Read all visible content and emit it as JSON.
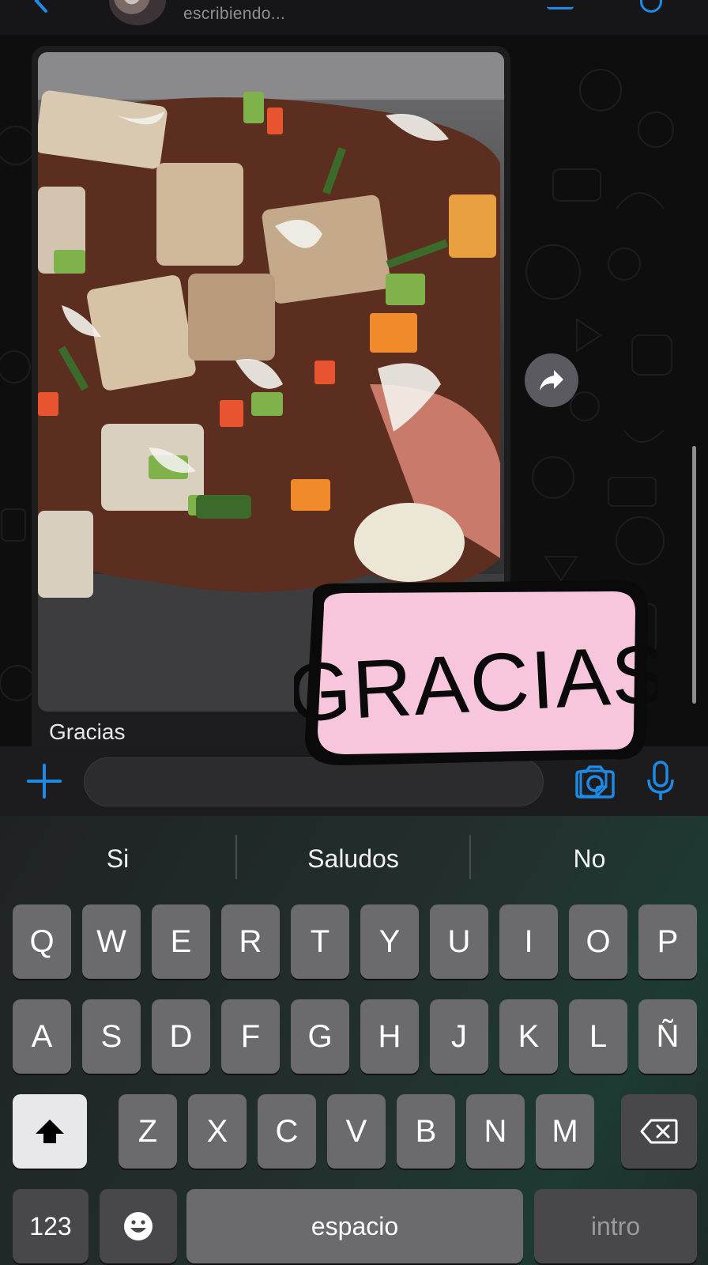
{
  "header": {
    "status": "escribiendo..."
  },
  "message": {
    "caption": "Gracias"
  },
  "sticker": {
    "text": "GRACIAS"
  },
  "input": {
    "value": "",
    "placeholder": ""
  },
  "keyboard": {
    "suggestions": [
      "Si",
      "Saludos",
      "No"
    ],
    "rows": [
      [
        "Q",
        "W",
        "E",
        "R",
        "T",
        "Y",
        "U",
        "I",
        "O",
        "P"
      ],
      [
        "A",
        "S",
        "D",
        "F",
        "G",
        "H",
        "J",
        "K",
        "L",
        "Ñ"
      ],
      [
        "Z",
        "X",
        "C",
        "V",
        "B",
        "N",
        "M"
      ]
    ],
    "numbers_label": "123",
    "space_label": "espacio",
    "return_label": "intro"
  },
  "colors": {
    "accent": "#1f8ae6",
    "sticker_bg": "#f8c6dc",
    "sticker_ink": "#0a0a0a"
  },
  "icons": {
    "back": "chevron-left-icon",
    "forward": "forward-arrow-icon",
    "add": "plus-icon",
    "sticker": "sticker-icon",
    "camera": "camera-icon",
    "mic": "microphone-icon",
    "shift": "shift-arrow-icon",
    "delete": "backspace-icon",
    "emoji": "emoji-icon"
  }
}
